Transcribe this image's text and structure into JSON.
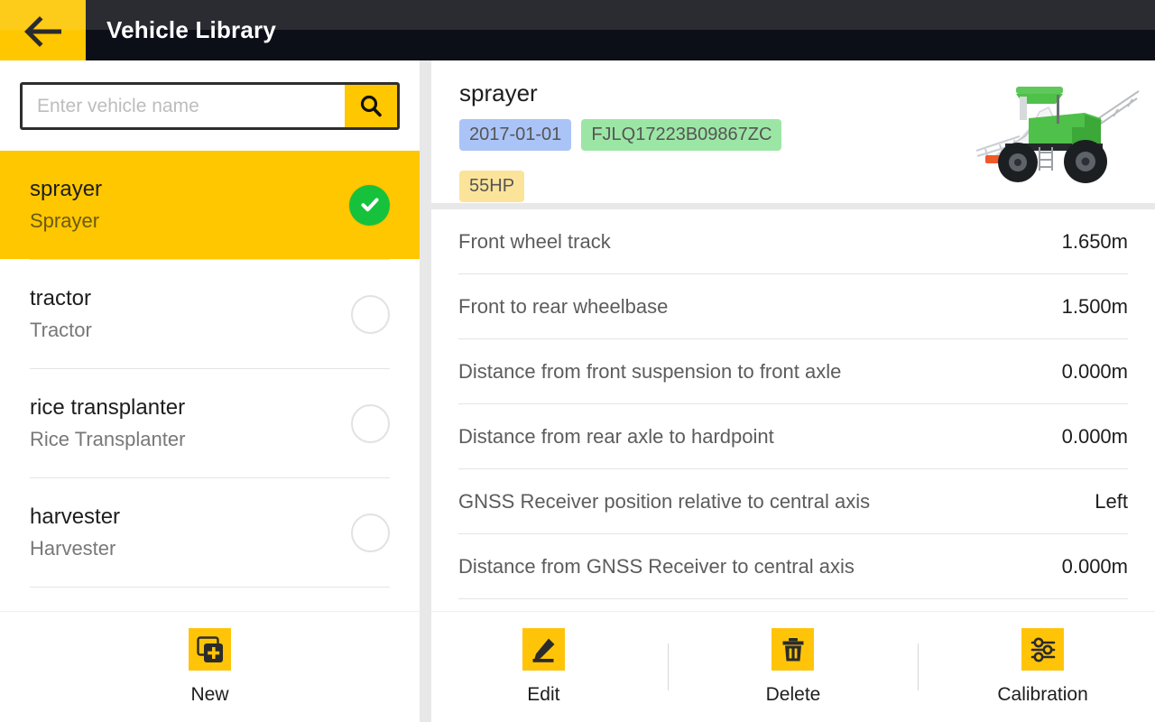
{
  "header": {
    "title": "Vehicle Library",
    "back_icon": "arrow-left-icon"
  },
  "search": {
    "placeholder": "Enter vehicle name",
    "value": "",
    "icon": "search-icon"
  },
  "vehicle_list": [
    {
      "name": "sprayer",
      "type": "Sprayer",
      "selected": true
    },
    {
      "name": "tractor",
      "type": "Tractor",
      "selected": false
    },
    {
      "name": "rice transplanter",
      "type": "Rice Transplanter",
      "selected": false
    },
    {
      "name": "harvester",
      "type": "Harvester",
      "selected": false
    }
  ],
  "detail": {
    "name": "sprayer",
    "chips": [
      {
        "text": "2017-01-01",
        "color": "#aac4f7"
      },
      {
        "text": "FJLQ17223B09867ZC",
        "color": "#9ce6a5"
      },
      {
        "text": "55HP",
        "color": "#fbe49a"
      }
    ],
    "image_alt": "sprayer-illustration",
    "specs": [
      {
        "label": "Front wheel track",
        "value": "1.650m"
      },
      {
        "label": "Front to rear wheelbase",
        "value": "1.500m"
      },
      {
        "label": "Distance from front suspension to front axle",
        "value": "0.000m"
      },
      {
        "label": "Distance from rear axle to hardpoint",
        "value": "0.000m"
      },
      {
        "label": "GNSS Receiver position relative to central axis",
        "value": "Left"
      },
      {
        "label": "Distance from GNSS Receiver to central axis",
        "value": "0.000m"
      }
    ]
  },
  "toolbar_left": {
    "new_label": "New",
    "new_icon": "add-card-icon"
  },
  "toolbar_right": {
    "edit_label": "Edit",
    "edit_icon": "pencil-icon",
    "delete_label": "Delete",
    "delete_icon": "trash-icon",
    "calibration_label": "Calibration",
    "calibration_icon": "sliders-icon"
  },
  "colors": {
    "accent": "#ffc700",
    "header_dark": "#0d0f18",
    "selected_row": "#ffc700",
    "check_green": "#16c23c"
  }
}
